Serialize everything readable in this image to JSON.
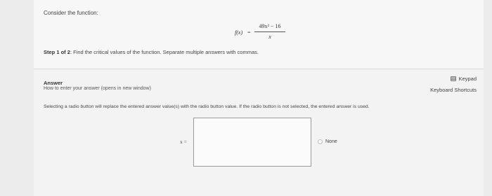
{
  "question": {
    "intro": "Consider the function:",
    "formula": {
      "lhs": "f(x)",
      "equals": "=",
      "numerator": "49x² − 16",
      "denominator": "x"
    },
    "step_prefix": "Step 1 of 2",
    "step_text": ": Find the critical values of the function. Separate multiple answers with commas."
  },
  "answer": {
    "label": "Answer",
    "how_to_link": "How to enter your answer (opens in new window)",
    "keypad_label": "Keypad",
    "shortcuts_label": "Keyboard Shortcuts",
    "notice": "Selecting a radio button will replace the entered answer value(s) with the radio button value. If the radio button is not selected, the entered answer is used.",
    "variable_label": "x =",
    "input_value": "",
    "radio_label": "None"
  }
}
